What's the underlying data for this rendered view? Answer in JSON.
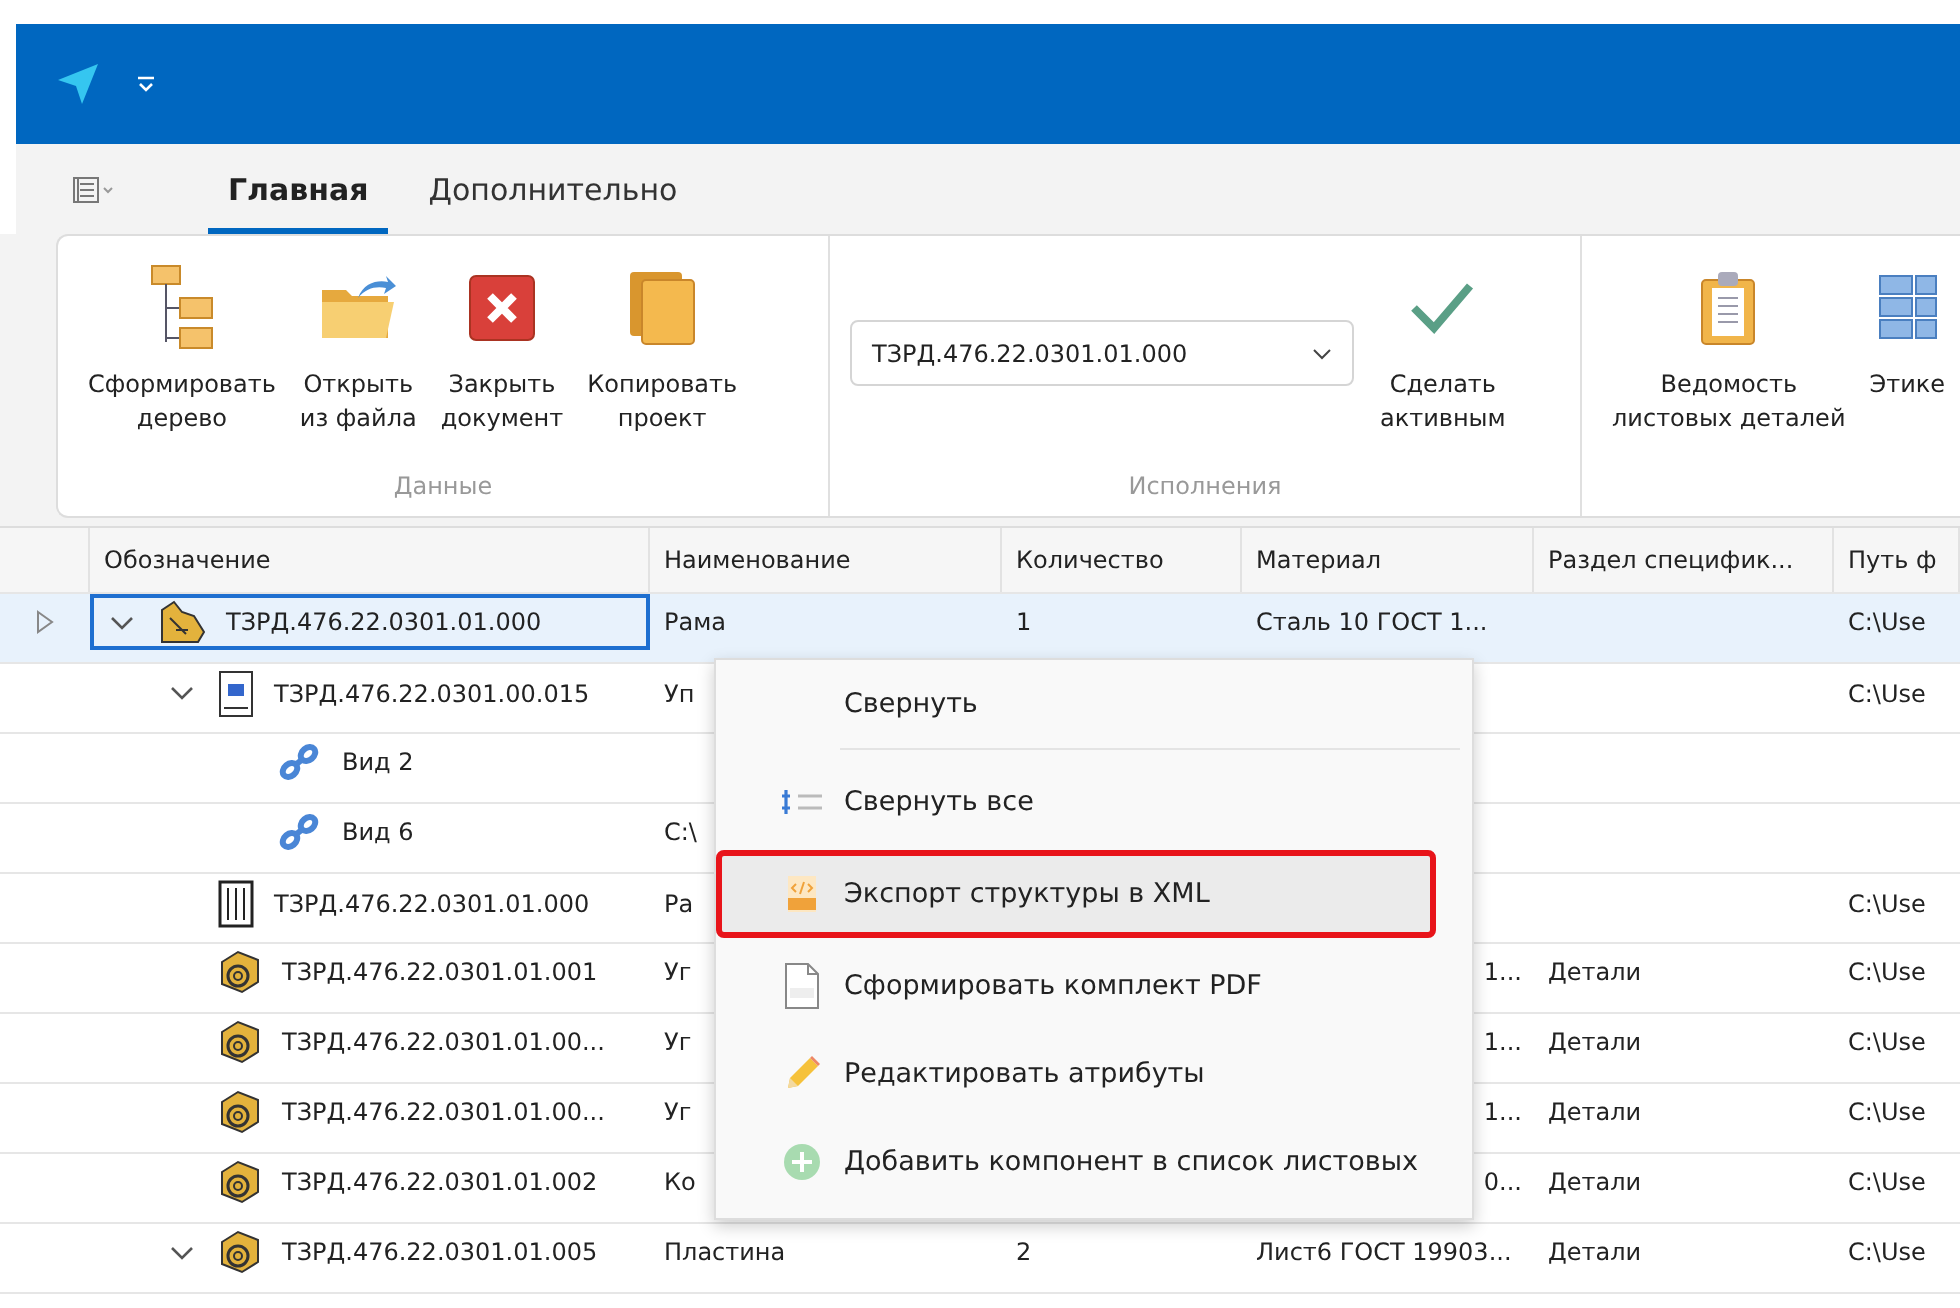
{
  "tabs": [
    {
      "label": "Главная",
      "selected": true
    },
    {
      "label": "Дополнительно",
      "selected": false
    }
  ],
  "ribbon": {
    "groups": [
      {
        "title": "Данные",
        "items": [
          {
            "kind": "button",
            "label": "Сформировать\nдерево"
          },
          {
            "kind": "button",
            "label": "Открыть\nиз файла"
          },
          {
            "kind": "button",
            "label": "Закрыть\nдокумент"
          },
          {
            "kind": "button",
            "label": "Копировать\nпроект"
          }
        ]
      },
      {
        "title": "Исполнения",
        "items": [
          {
            "kind": "dropdown",
            "value": "ТЗРД.476.22.0301.01.000"
          },
          {
            "kind": "button",
            "label": "Сделать\nактивным"
          }
        ]
      },
      {
        "items": [
          {
            "kind": "button",
            "label": "Ведомость\nлистовых деталей"
          },
          {
            "kind": "button",
            "label": "Этике"
          }
        ]
      }
    ]
  },
  "table": {
    "columns": [
      "Обозначение",
      "Наименование",
      "Количество",
      "Материал",
      "Раздел специфик...",
      "Путь ф"
    ],
    "rows": [
      {
        "kind": "assembly",
        "selected": true,
        "expanded": true,
        "cells": [
          "ТЗРД.476.22.0301.01.000",
          "Рама",
          "1",
          "Сталь 10 ГОСТ 1...",
          "",
          "C:\\Use"
        ],
        "children": [
          {
            "kind": "drawing",
            "selected": false,
            "expanded": true,
            "cells": [
              "ТЗРД.476.22.0301.00.015",
              "Уп",
              "",
              "",
              "",
              "C:\\Use"
            ],
            "children": [
              {
                "kind": "view",
                "selected": false,
                "cells": [
                  "Вид 2",
                  "",
                  "",
                  "",
                  "",
                  ""
                ]
              },
              {
                "kind": "view",
                "selected": false,
                "cells": [
                  "Вид 6",
                  "C:\\",
                  "",
                  "",
                  "",
                  ""
                ]
              }
            ]
          },
          {
            "kind": "spec",
            "selected": false,
            "cells": [
              "ТЗРД.476.22.0301.01.000",
              "Ра",
              "",
              "",
              "",
              "C:\\Use"
            ]
          },
          {
            "kind": "part",
            "selected": false,
            "cells": [
              "ТЗРД.476.22.0301.01.001",
              "Уг",
              "",
              "1...",
              "Детали",
              "C:\\Use"
            ]
          },
          {
            "kind": "part",
            "selected": false,
            "cells": [
              "ТЗРД.476.22.0301.01.00...",
              "Уг",
              "",
              "1...",
              "Детали",
              "C:\\Use"
            ]
          },
          {
            "kind": "part",
            "selected": false,
            "cells": [
              "ТЗРД.476.22.0301.01.00...",
              "Уг",
              "",
              "1...",
              "Детали",
              "C:\\Use"
            ]
          },
          {
            "kind": "part",
            "selected": false,
            "cells": [
              "ТЗРД.476.22.0301.01.002",
              "Ко",
              "",
              "0...",
              "Детали",
              "C:\\Use"
            ]
          },
          {
            "kind": "part",
            "selected": false,
            "expanded": true,
            "cells": [
              "ТЗРД.476.22.0301.01.005",
              "Пластина",
              "2",
              "Лист6 ГОСТ 19903...",
              "Детали",
              "C:\\Use"
            ]
          }
        ]
      }
    ]
  },
  "context_menu": {
    "items": [
      {
        "kind": "item",
        "label": "Свернуть",
        "selected": false
      },
      {
        "kind": "separator"
      },
      {
        "kind": "item",
        "label": "Свернуть все",
        "selected": false
      },
      {
        "kind": "item",
        "label": "Экспорт структуры в XML",
        "selected": true
      },
      {
        "kind": "item",
        "label": "Сформировать комплект PDF",
        "selected": false
      },
      {
        "kind": "item",
        "label": "Редактировать атрибуты",
        "selected": false
      },
      {
        "kind": "item",
        "label": "Добавить компонент в список листовых",
        "selected": false
      }
    ]
  }
}
